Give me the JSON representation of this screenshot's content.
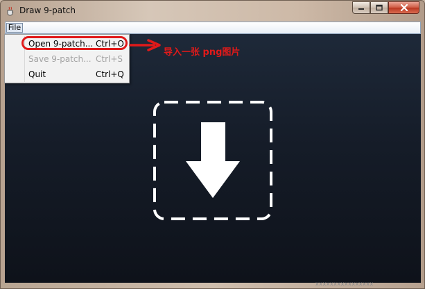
{
  "window": {
    "title": "Draw 9-patch",
    "icons": {
      "app": "java-cup-icon",
      "minimize": "minimize-icon",
      "maximize": "maximize-icon",
      "close": "close-icon"
    }
  },
  "menubar": {
    "file_label": "File"
  },
  "file_menu": {
    "items": [
      {
        "label": "Open 9-patch...",
        "shortcut": "Ctrl+O",
        "enabled": true
      },
      {
        "label": "Save 9-patch...",
        "shortcut": "Ctrl+S",
        "enabled": false
      },
      {
        "label": "Quit",
        "shortcut": "Ctrl+Q",
        "enabled": true
      }
    ]
  },
  "annotation": {
    "text": "导入一张 png图片",
    "color": "#e01a1a"
  },
  "drop_area": {
    "icon": "download-arrow-icon"
  },
  "watermark": {
    "text": "xxxxxxxxxxxxxxxx"
  },
  "colors": {
    "content_bg_top": "#1e2939",
    "content_bg_bottom": "#0e121a",
    "annotation_red": "#e01a1a"
  }
}
